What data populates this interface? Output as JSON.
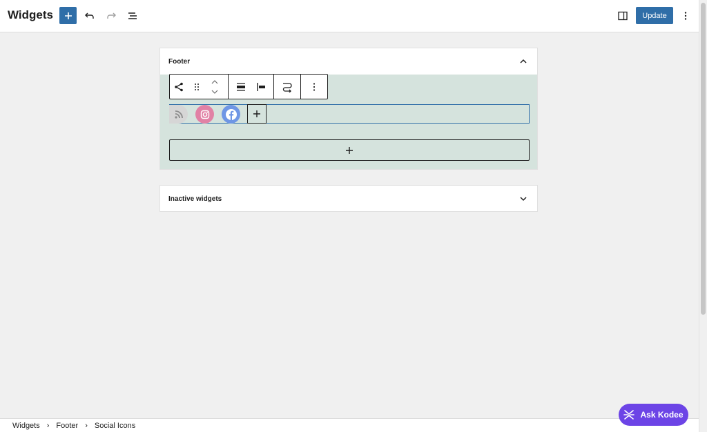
{
  "header": {
    "title": "Widgets",
    "update_label": "Update"
  },
  "areas": {
    "footer": {
      "title": "Footer",
      "social_icons": [
        "rss-icon",
        "instagram-icon",
        "facebook-icon"
      ]
    },
    "inactive": {
      "title": "Inactive widgets"
    }
  },
  "breadcrumb": [
    "Widgets",
    "Footer",
    "Social Icons"
  ],
  "assistant": {
    "label": "Ask Kodee"
  },
  "colors": {
    "accent": "#2f6ea8",
    "footer_bg": "#d5e3dd",
    "rss": "#d6d6d6",
    "instagram": "#e181a5",
    "facebook": "#6f96e5",
    "kodee": "#6c44e6"
  }
}
